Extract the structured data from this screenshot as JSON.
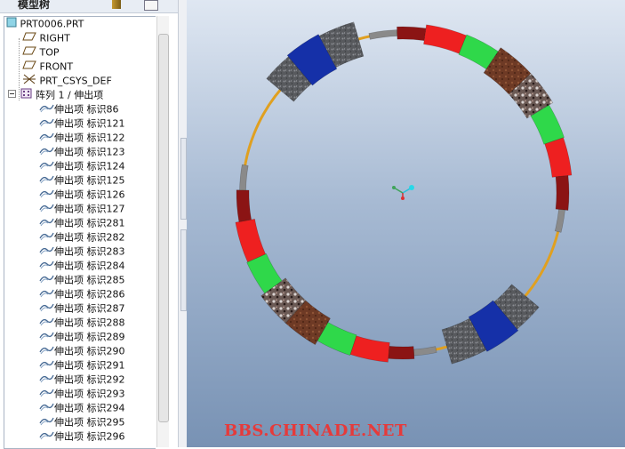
{
  "header": {
    "title": "模型树"
  },
  "tree": {
    "root": "PRT0006.PRT",
    "datums": [
      "RIGHT",
      "TOP",
      "FRONT"
    ],
    "csys": "PRT_CSYS_DEF",
    "pattern": "阵列 1 / 伸出项",
    "items": [
      "伸出项 标识86",
      "伸出项 标识121",
      "伸出项 标识122",
      "伸出项 标识123",
      "伸出项 标识124",
      "伸出项 标识125",
      "伸出项 标识126",
      "伸出项 标识127",
      "伸出项 标识281",
      "伸出项 标识282",
      "伸出项 标识283",
      "伸出项 标识284",
      "伸出项 标识285",
      "伸出项 标识286",
      "伸出项 标识287",
      "伸出项 标识288",
      "伸出项 标识289",
      "伸出项 标识290",
      "伸出项 标识291",
      "伸出项 标识292",
      "伸出项 标识293",
      "伸出项 标识294",
      "伸出项 标识295",
      "伸出项 标识296"
    ]
  },
  "watermark": "BBS.CHINADE.NET",
  "colors": {
    "ring": "#e0a020",
    "gray": "#8a8a8a",
    "dark_red": "#8b1414",
    "red": "#ee2020",
    "green": "#2fd84a",
    "blue": "#1530a8",
    "stone": "#585a5e",
    "rust": "#6e3a25"
  },
  "icons": {
    "root": "part-icon",
    "datum": "datum-plane-icon",
    "csys": "csys-icon",
    "pattern": "pattern-icon",
    "extrude": "extrude-icon"
  }
}
